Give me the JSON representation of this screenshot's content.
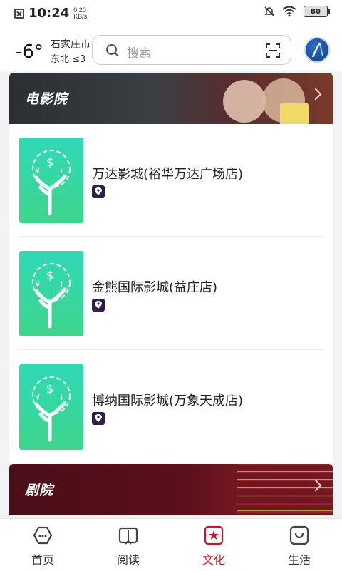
{
  "status_bar": {
    "time": "10:24",
    "net_speed_value": "0.20",
    "net_speed_unit": "KB/s",
    "battery": "80"
  },
  "header": {
    "temperature": "-6°",
    "city": "石家庄市",
    "wind": "东北 ≤3",
    "search_placeholder": "搜索"
  },
  "sections": {
    "cinema_title": "电影院",
    "theatre_title": "剧院"
  },
  "cinemas": [
    {
      "name": "万达影城(裕华万达广场店)"
    },
    {
      "name": "金熊国际影城(益庄店)"
    },
    {
      "name": "博纳国际影城(万象天成店)"
    }
  ],
  "tabs": [
    {
      "label": "首页",
      "icon": "home-hex-icon"
    },
    {
      "label": "阅读",
      "icon": "book-icon"
    },
    {
      "label": "文化",
      "icon": "star-box-icon",
      "active": true
    },
    {
      "label": "生活",
      "icon": "bag-icon"
    }
  ],
  "colors": {
    "accent": "#c0192f",
    "thumb_green": "#34d8a8"
  }
}
